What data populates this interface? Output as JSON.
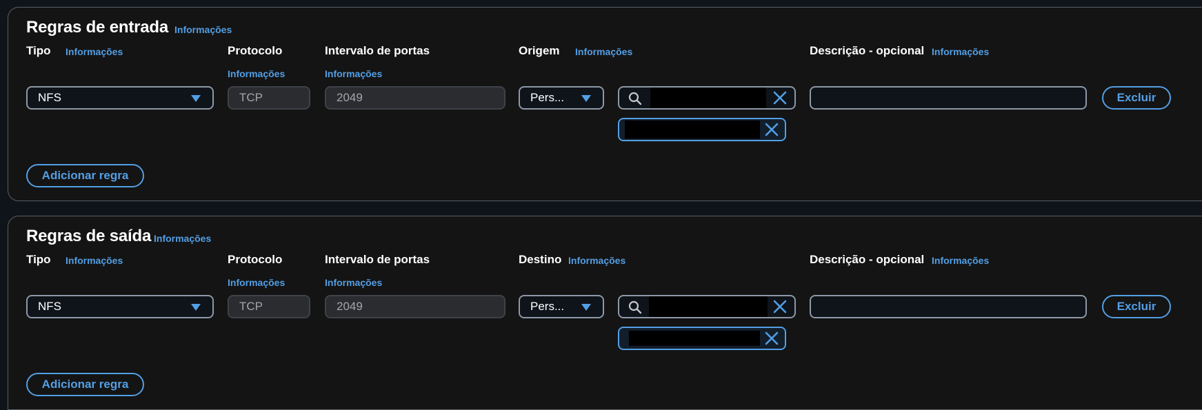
{
  "inbound": {
    "title": "Regras de entrada",
    "title_info": "Informações",
    "headers": {
      "type": "Tipo",
      "type_info": "Informações",
      "protocol": "Protocolo",
      "protocol_info": "Informações",
      "port_range": "Intervalo de portas",
      "port_range_info": "Informações",
      "source": "Origem",
      "source_info": "Informações",
      "description": "Descrição - opcional",
      "description_info": "Informações"
    },
    "rule": {
      "type_value": "NFS",
      "protocol_value": "TCP",
      "port_value": "2049",
      "source_value": "Pers...",
      "search_value": "",
      "description_value": "",
      "delete_label": "Excluir"
    },
    "add_rule_label": "Adicionar regra"
  },
  "outbound": {
    "title": "Regras de saída",
    "title_info": "Informações",
    "headers": {
      "type": "Tipo",
      "type_info": "Informações",
      "protocol": "Protocolo",
      "protocol_info": "Informações",
      "port_range": "Intervalo de portas",
      "port_range_info": "Informações",
      "destination": "Destino",
      "destination_info": "Informações",
      "description": "Descrição - opcional",
      "description_info": "Informações"
    },
    "rule": {
      "type_value": "NFS",
      "protocol_value": "TCP",
      "port_value": "2049",
      "destination_value": "Pers...",
      "search_value": "",
      "description_value": "",
      "delete_label": "Excluir"
    },
    "add_rule_label": "Adicionar regra"
  },
  "icons": {
    "caret": "caret-down-icon",
    "search": "search-icon",
    "clear": "close-icon"
  },
  "colors": {
    "accent": "#539fe5",
    "panel_bg": "#141414",
    "border": "#8d99a8"
  }
}
